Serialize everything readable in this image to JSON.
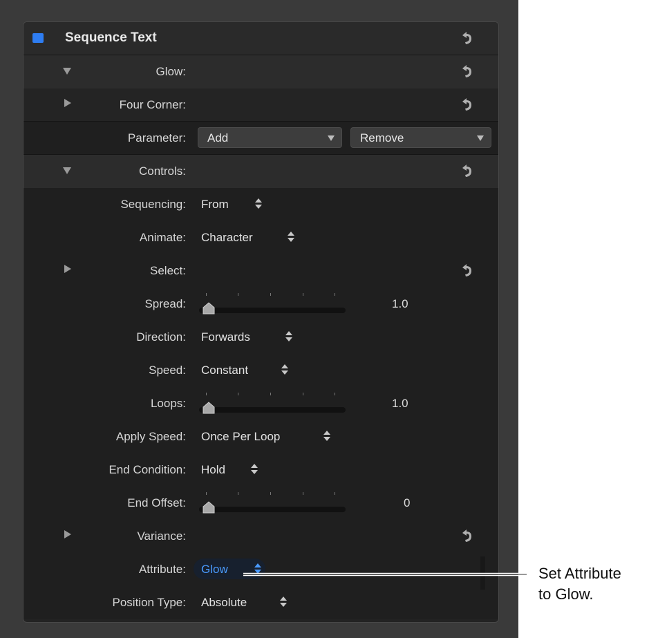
{
  "panel": {
    "title": "Sequence Text",
    "rows": {
      "glow": "Glow:",
      "four_corner": "Four Corner:",
      "parameter": "Parameter:",
      "add_label": "Add",
      "remove_label": "Remove",
      "controls": "Controls:",
      "sequencing": {
        "label": "Sequencing:",
        "value": "From"
      },
      "animate": {
        "label": "Animate:",
        "value": "Character"
      },
      "select": "Select:",
      "spread": {
        "label": "Spread:",
        "value": "1.0"
      },
      "direction": {
        "label": "Direction:",
        "value": "Forwards"
      },
      "speed": {
        "label": "Speed:",
        "value": "Constant"
      },
      "loops": {
        "label": "Loops:",
        "value": "1.0"
      },
      "apply_speed": {
        "label": "Apply Speed:",
        "value": "Once Per Loop"
      },
      "end_condition": {
        "label": "End Condition:",
        "value": "Hold"
      },
      "end_offset": {
        "label": "End Offset:",
        "value": "0"
      },
      "variance": "Variance:",
      "attribute": {
        "label": "Attribute:",
        "value": "Glow"
      },
      "position_type": {
        "label": "Position Type:",
        "value": "Absolute"
      }
    }
  },
  "callout": {
    "line1": "Set Attribute",
    "line2": "to Glow."
  },
  "colors": {
    "accent": "#2e7df2",
    "selected_text": "#4a9bff"
  }
}
